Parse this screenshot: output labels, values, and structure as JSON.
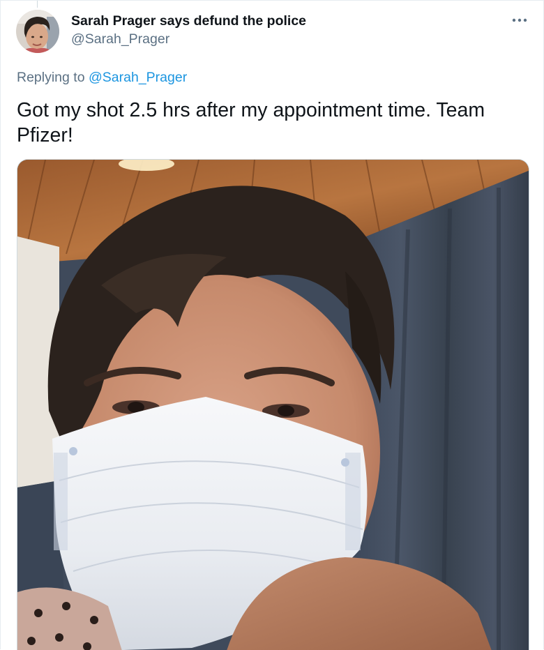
{
  "tweet": {
    "author": {
      "display_name": "Sarah Prager says defund the police",
      "handle": "@Sarah_Prager"
    },
    "replying_prefix": "Replying to ",
    "replying_to": "@Sarah_Prager",
    "text": "Got my shot 2.5 hrs after my appointment time. Team Pfizer!",
    "more_icon": "more-horizontal-icon",
    "media": {
      "type": "photo"
    }
  },
  "colors": {
    "text_primary": "#0f1419",
    "text_secondary": "#5b7083",
    "link": "#1b95e0",
    "border": "#e6ecf0"
  }
}
